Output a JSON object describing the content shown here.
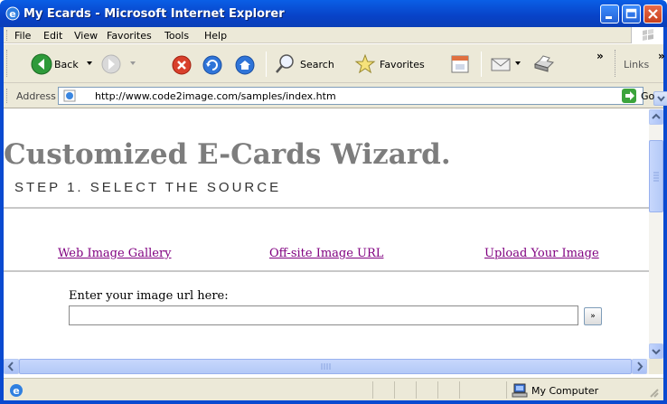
{
  "window": {
    "title": "My Ecards - Microsoft Internet Explorer"
  },
  "menu": {
    "items": [
      {
        "label": "File",
        "accel": "F"
      },
      {
        "label": "Edit",
        "accel": "E"
      },
      {
        "label": "View",
        "accel": "V"
      },
      {
        "label": "Favorites",
        "accel": "a"
      },
      {
        "label": "Tools",
        "accel": "T"
      },
      {
        "label": "Help",
        "accel": "H"
      }
    ]
  },
  "toolbar": {
    "back_label": "Back",
    "search_label": "Search",
    "favorites_label": "Favorites",
    "links_label": "Links",
    "chevron": "»"
  },
  "address": {
    "label": "Address",
    "url": "http://www.code2image.com/samples/index.htm",
    "go_label": "Go"
  },
  "page": {
    "title": "Customized E-Cards Wizard.",
    "subtitle": "STEP 1. SELECT THE SOURCE",
    "nav_links": [
      "Web Image Gallery",
      "Off-site Image URL",
      "Upload Your Image"
    ],
    "url_prompt": "Enter your image url here:",
    "url_value": "",
    "submit_label": "»"
  },
  "status": {
    "zone": "My Computer",
    "text": ""
  },
  "colors": {
    "titlebar": "#0842c7",
    "title_text": "#7d7d7d",
    "link_visited": "#800080",
    "chrome": "#ece9d8"
  }
}
